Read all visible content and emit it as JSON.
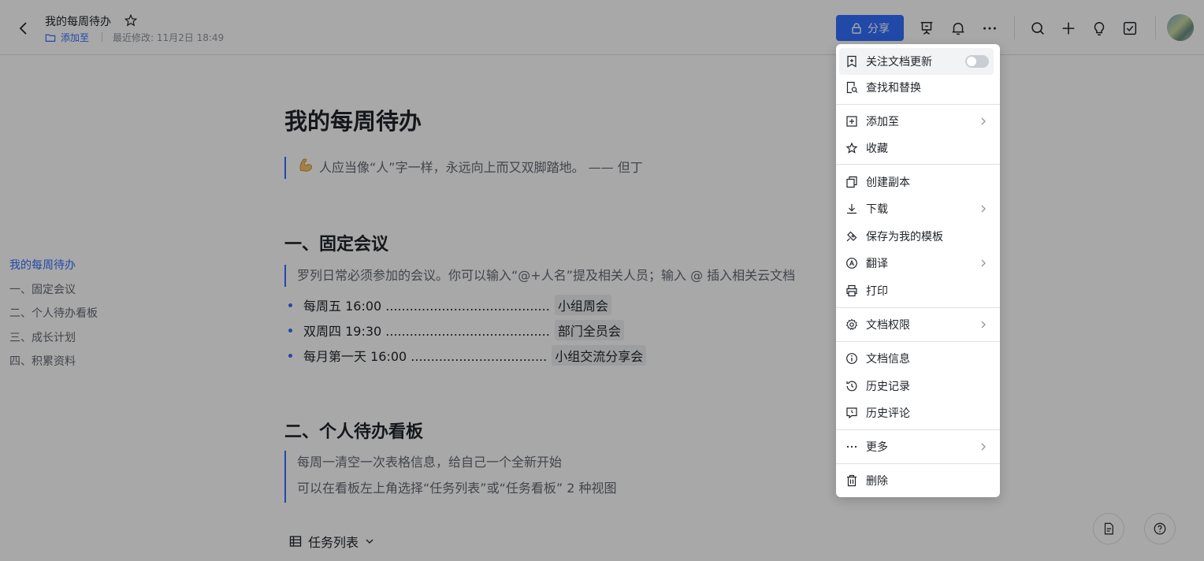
{
  "header": {
    "doc_title": "我的每周待办",
    "add_to": "添加至",
    "last_modified": "最近修改: 11月2日 18:49",
    "share": "分享"
  },
  "toc": [
    "我的每周待办",
    "一、固定会议",
    "二、个人待办看板",
    "三、成长计划",
    "四、积累资料"
  ],
  "doc": {
    "title": "我的每周待办",
    "quote": "人应当像“人”字一样，永远向上而又双脚踏地。 —— 但丁",
    "section1": {
      "heading": "一、固定会议",
      "hint": "罗列日常必须参加的会议。你可以输入“@+人名”提及相关人员；输入 @ 插入相关云文档",
      "items": [
        {
          "time": "每周五 16:00 .........................................",
          "chip": "小组周会"
        },
        {
          "time": "双周四 19:30 .........................................",
          "chip": "部门全员会"
        },
        {
          "time": "每月第一天 16:00  ..................................",
          "chip": "小组交流分享会"
        }
      ]
    },
    "section2": {
      "heading": "二、个人待办看板",
      "hint1": "每周一清空一次表格信息，给自己一个全新开始",
      "hint2": "可以在看板左上角选择“任务列表”或“任务看板” 2 种视图"
    },
    "task_view": "任务列表"
  },
  "menu": {
    "follow": "关注文档更新",
    "find_replace": "查找和替换",
    "add_to": "添加至",
    "favorite": "收藏",
    "copy": "创建副本",
    "download": "下载",
    "save_template": "保存为我的模板",
    "translate": "翻译",
    "print": "打印",
    "permissions": "文档权限",
    "doc_info": "文档信息",
    "history": "历史记录",
    "history_comments": "历史评论",
    "more": "更多",
    "delete": "删除"
  },
  "colors": {
    "accent": "#3370ff",
    "text": "#1f2329",
    "muted": "#646a73"
  }
}
